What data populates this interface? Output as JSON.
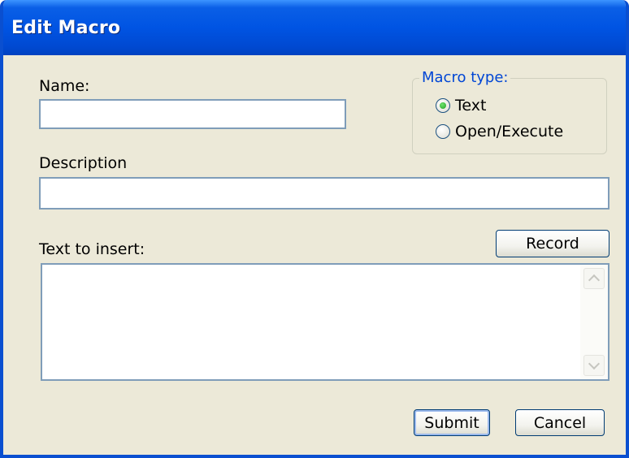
{
  "window": {
    "title": "Edit Macro"
  },
  "form": {
    "name_label": "Name:",
    "name_value": "",
    "description_label": "Description",
    "description_value": "",
    "text_label": "Text to insert:",
    "text_value": ""
  },
  "macro_type": {
    "legend": "Macro type:",
    "options": [
      {
        "label": "Text",
        "checked": true
      },
      {
        "label": "Open/Execute",
        "checked": false
      }
    ]
  },
  "buttons": {
    "record": "Record",
    "submit": "Submit",
    "cancel": "Cancel"
  },
  "icons": {
    "scroll_up": "chevron-up-icon",
    "scroll_down": "chevron-down-icon"
  },
  "colors": {
    "title_bar": "#0054e3",
    "window_bg": "#ece9d8",
    "group_legend": "#0046d5",
    "input_border": "#7f9db9"
  }
}
